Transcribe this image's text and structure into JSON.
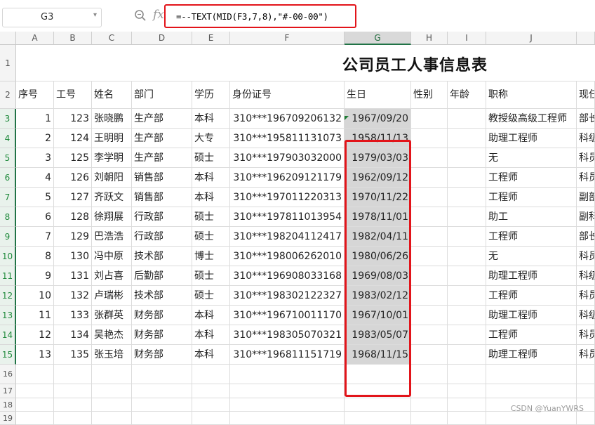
{
  "formula_bar": {
    "name_box": "G3",
    "fx_label": "fx",
    "formula": "=--TEXT(MID(F3,7,8),\"#-00-00\")"
  },
  "columns": [
    "A",
    "B",
    "C",
    "D",
    "E",
    "F",
    "G",
    "H",
    "I",
    "J"
  ],
  "row_numbers": [
    "1",
    "2",
    "3",
    "4",
    "5",
    "6",
    "7",
    "8",
    "9",
    "10",
    "11",
    "12",
    "13",
    "14",
    "15",
    "16",
    "17",
    "18",
    "19"
  ],
  "sheet_title": "公司员工人事信息表",
  "headers": [
    "序号",
    "工号",
    "姓名",
    "部门",
    "学历",
    "身份证号",
    "生日",
    "性别",
    "年龄",
    "职称",
    "现任"
  ],
  "rows": [
    {
      "seq": "1",
      "id": "123",
      "name": "张晓鹏",
      "dept": "生产部",
      "edu": "本科",
      "idno": "310***196709206132",
      "birth": "1967/09/20",
      "title": "教授级高级工程师",
      "post": "部长"
    },
    {
      "seq": "2",
      "id": "124",
      "name": "王明明",
      "dept": "生产部",
      "edu": "大专",
      "idno": "310***195811131073",
      "birth": "1958/11/13",
      "title": "助理工程师",
      "post": "科级"
    },
    {
      "seq": "3",
      "id": "125",
      "name": "李学明",
      "dept": "生产部",
      "edu": "硕士",
      "idno": "310***197903032000",
      "birth": "1979/03/03",
      "title": "无",
      "post": "科员"
    },
    {
      "seq": "4",
      "id": "126",
      "name": "刘朝阳",
      "dept": "销售部",
      "edu": "本科",
      "idno": "310***196209121179",
      "birth": "1962/09/12",
      "title": "工程师",
      "post": "科员"
    },
    {
      "seq": "5",
      "id": "127",
      "name": "齐跃文",
      "dept": "销售部",
      "edu": "本科",
      "idno": "310***197011220313",
      "birth": "1970/11/22",
      "title": "工程师",
      "post": "副部"
    },
    {
      "seq": "6",
      "id": "128",
      "name": "徐翔展",
      "dept": "行政部",
      "edu": "硕士",
      "idno": "310***197811013954",
      "birth": "1978/11/01",
      "title": "助工",
      "post": "副科"
    },
    {
      "seq": "7",
      "id": "129",
      "name": "巴浩浩",
      "dept": "行政部",
      "edu": "硕士",
      "idno": "310***198204112417",
      "birth": "1982/04/11",
      "title": "工程师",
      "post": "部长"
    },
    {
      "seq": "8",
      "id": "130",
      "name": "冯中原",
      "dept": "技术部",
      "edu": "博士",
      "idno": "310***198006262010",
      "birth": "1980/06/26",
      "title": "无",
      "post": "科员"
    },
    {
      "seq": "9",
      "id": "131",
      "name": "刘占喜",
      "dept": "后勤部",
      "edu": "硕士",
      "idno": "310***196908033168",
      "birth": "1969/08/03",
      "title": "助理工程师",
      "post": "科级"
    },
    {
      "seq": "10",
      "id": "132",
      "name": "卢瑞彬",
      "dept": "技术部",
      "edu": "硕士",
      "idno": "310***198302122327",
      "birth": "1983/02/12",
      "title": "工程师",
      "post": "科员"
    },
    {
      "seq": "11",
      "id": "133",
      "name": "张群英",
      "dept": "财务部",
      "edu": "本科",
      "idno": "310***196710011170",
      "birth": "1967/10/01",
      "title": "助理工程师",
      "post": "科级"
    },
    {
      "seq": "12",
      "id": "134",
      "name": "吴艳杰",
      "dept": "财务部",
      "edu": "本科",
      "idno": "310***198305070321",
      "birth": "1983/05/07",
      "title": "工程师",
      "post": "科员"
    },
    {
      "seq": "13",
      "id": "135",
      "name": "张玉培",
      "dept": "财务部",
      "edu": "本科",
      "idno": "310***196811151719",
      "birth": "1968/11/15",
      "title": "助理工程师",
      "post": "科员"
    }
  ],
  "watermark": "CSDN @YuanYWRS",
  "colors": {
    "highlight_border": "#e2141a",
    "selected_fill": "#d6d6d6",
    "accent_green": "#217346"
  }
}
